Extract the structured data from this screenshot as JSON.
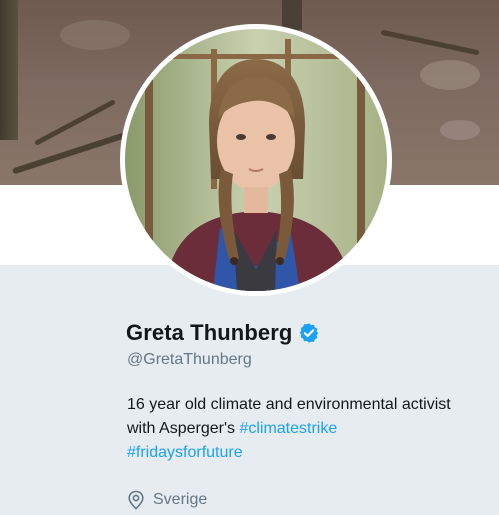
{
  "profile": {
    "name": "Greta Thunberg",
    "verified": true,
    "handle": "@GretaThunberg",
    "bio_text": "16 year old climate and environmental activist with Asperger's",
    "hashtags": [
      "#climatestrike",
      "#fridaysforfuture"
    ],
    "location": "Sverige"
  },
  "icons": {
    "verified": "verified-badge-icon",
    "location": "location-pin-icon"
  },
  "colors": {
    "accent": "#1da1f2",
    "page_background": "#e6ecf0",
    "name_text": "#14171a",
    "secondary_text": "#657786"
  }
}
